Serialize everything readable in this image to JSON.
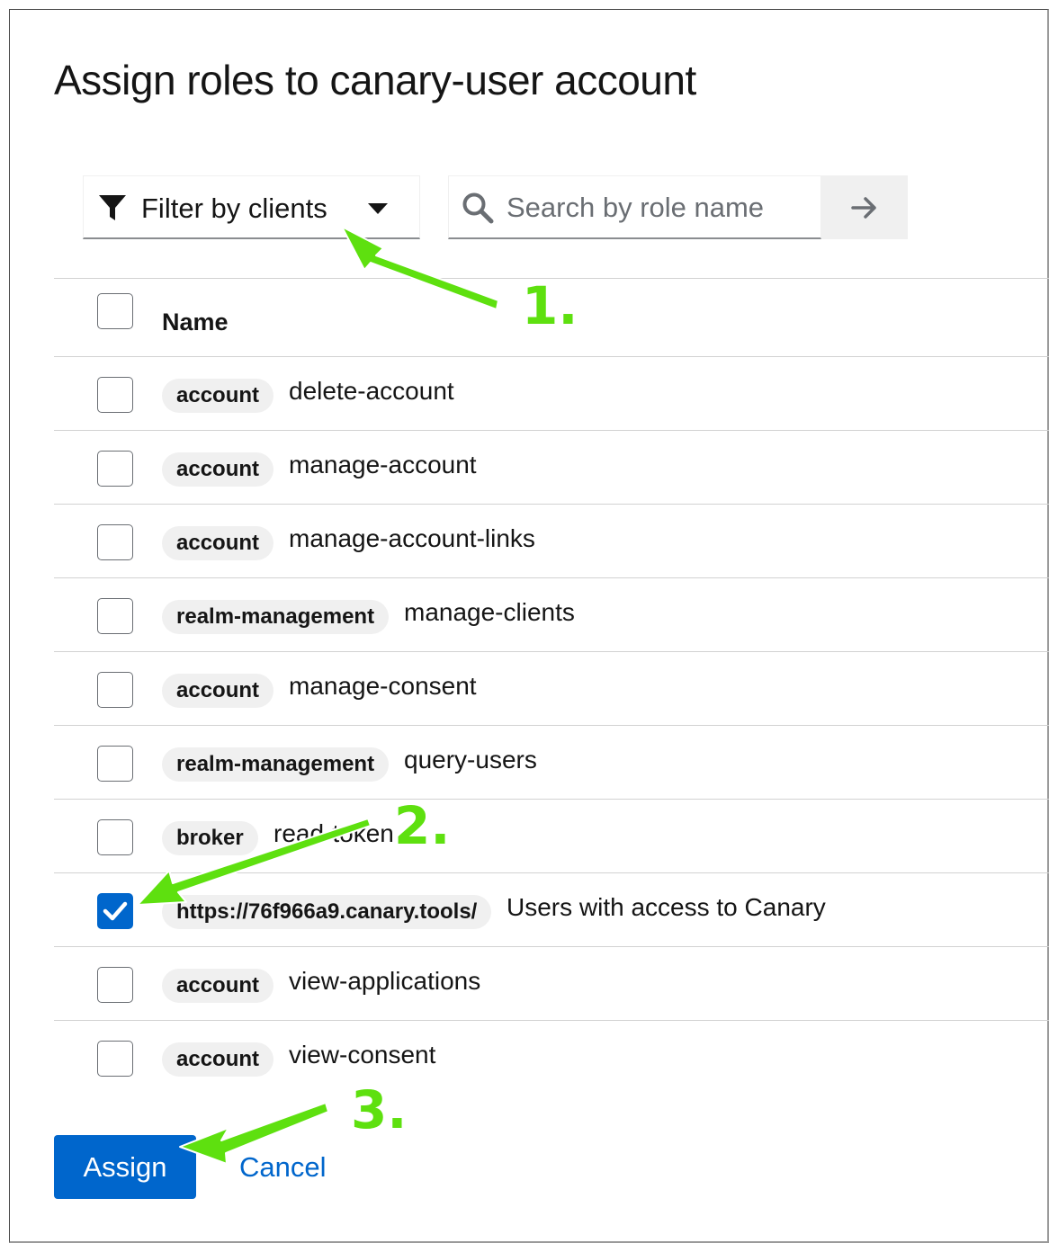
{
  "dialog": {
    "title": "Assign roles to canary-user account"
  },
  "toolbar": {
    "filter_label": "Filter by clients",
    "search_placeholder": "Search by role name"
  },
  "table": {
    "header_name": "Name",
    "rows": [
      {
        "client": "account",
        "role": "delete-account",
        "checked": false
      },
      {
        "client": "account",
        "role": "manage-account",
        "checked": false
      },
      {
        "client": "account",
        "role": "manage-account-links",
        "checked": false
      },
      {
        "client": "realm-management",
        "role": "manage-clients",
        "checked": false
      },
      {
        "client": "account",
        "role": "manage-consent",
        "checked": false
      },
      {
        "client": "realm-management",
        "role": "query-users",
        "checked": false
      },
      {
        "client": "broker",
        "role": "read-token",
        "checked": false
      },
      {
        "client": "https://76f966a9.canary.tools/",
        "role": "Users with access to Canary",
        "checked": true
      },
      {
        "client": "account",
        "role": "view-applications",
        "checked": false
      },
      {
        "client": "account",
        "role": "view-consent",
        "checked": false
      }
    ]
  },
  "actions": {
    "assign_label": "Assign",
    "cancel_label": "Cancel"
  },
  "annotations": {
    "step1": "1.",
    "step2": "2.",
    "step3": "3.",
    "arrow_color": "#5ee00f"
  },
  "colors": {
    "primary": "#0066cc",
    "chip_bg": "#f0f0f0",
    "divider": "#d2d2d2"
  }
}
